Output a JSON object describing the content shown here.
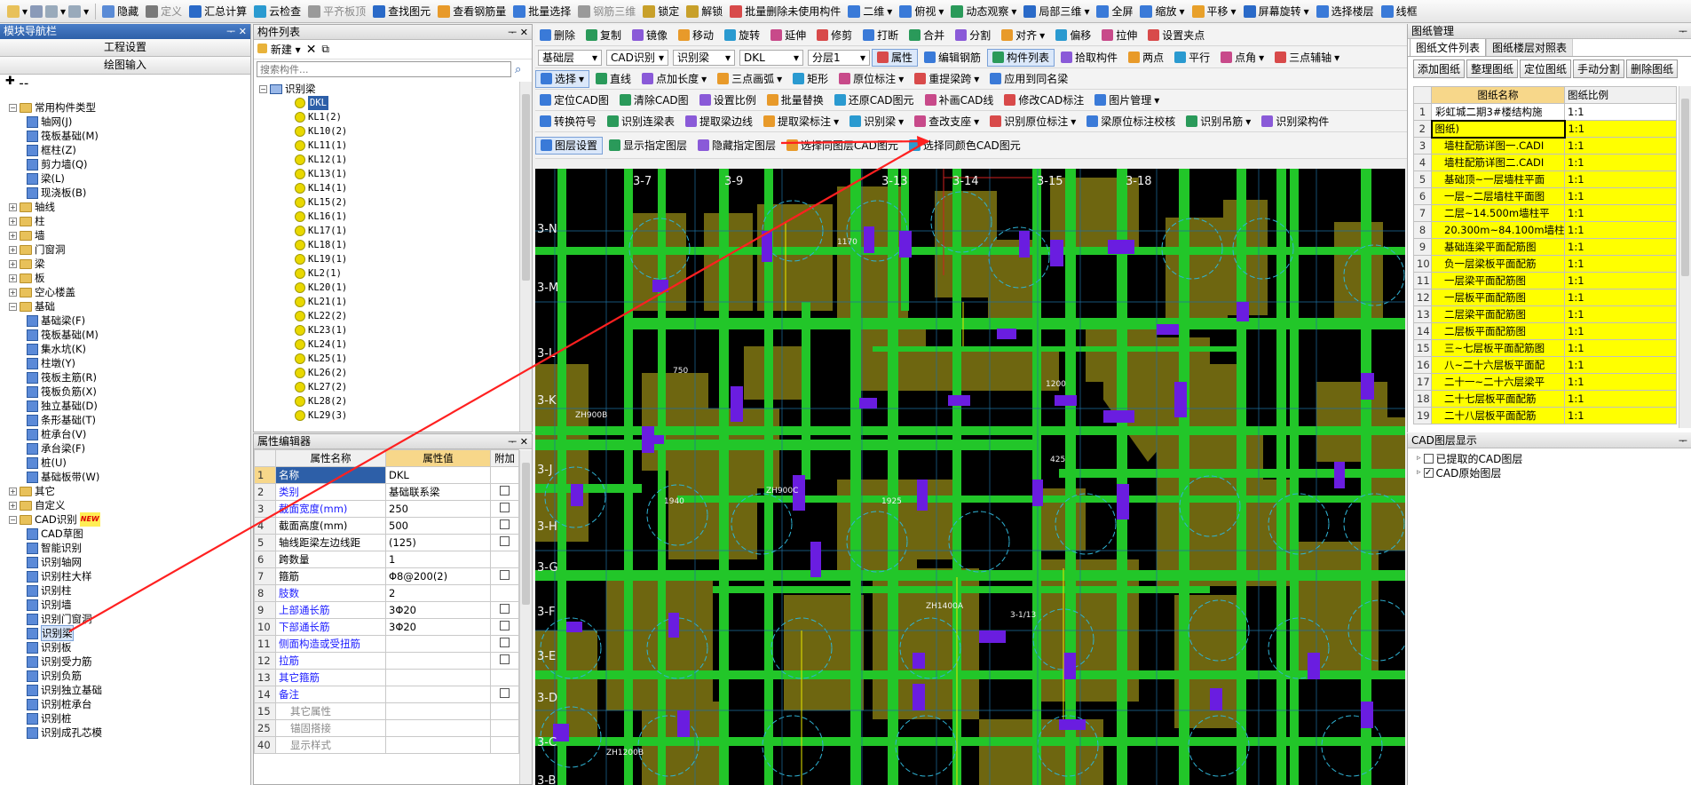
{
  "toolbar": [
    "隐藏",
    "定义",
    "汇总计算",
    "云检查",
    "平齐板顶",
    "查找图元",
    "查看钢筋量",
    "批量选择",
    "钢筋三维",
    "锁定",
    "解锁",
    "批量删除未使用构件",
    "二维",
    "俯视",
    "动态观察",
    "局部三维",
    "全屏",
    "缩放",
    "平移",
    "屏幕旋转",
    "选择楼层",
    "线框"
  ],
  "nav": {
    "title": "模块导航栏",
    "btn1": "工程设置",
    "btn2": "绘图输入",
    "tree": [
      "常用构件类型",
      "轴网(J)",
      "筏板基础(M)",
      "框柱(Z)",
      "剪力墙(Q)",
      "梁(L)",
      "现浇板(B)",
      "轴线",
      "柱",
      "墙",
      "门窗洞",
      "梁",
      "板",
      "空心楼盖",
      "基础",
      "基础梁(F)",
      "筏板基础(M)",
      "集水坑(K)",
      "柱墩(Y)",
      "筏板主筋(R)",
      "筏板负筋(X)",
      "独立基础(D)",
      "条形基础(T)",
      "桩承台(V)",
      "承台梁(F)",
      "桩(U)",
      "基础板带(W)",
      "其它",
      "自定义",
      "CAD识别",
      "CAD草图",
      "智能识别",
      "识别轴网",
      "识别柱大样",
      "识别柱",
      "识别墙",
      "识别门窗洞",
      "识别梁",
      "识别板",
      "识别受力筋",
      "识别负筋",
      "识别独立基础",
      "识别桩承台",
      "识别桩",
      "识别成孔芯模"
    ],
    "new_badge": "NEW"
  },
  "comp": {
    "title": "构件列表",
    "new": "新建",
    "search_ph": "搜索构件...",
    "root": "识别梁",
    "items": [
      "DKL",
      "KL1(2)",
      "KL10(2)",
      "KL11(1)",
      "KL12(1)",
      "KL13(1)",
      "KL14(1)",
      "KL15(2)",
      "KL16(1)",
      "KL17(1)",
      "KL18(1)",
      "KL19(1)",
      "KL2(1)",
      "KL20(1)",
      "KL21(1)",
      "KL22(2)",
      "KL23(1)",
      "KL24(1)",
      "KL25(1)",
      "KL26(2)",
      "KL27(2)",
      "KL28(2)",
      "KL29(3)"
    ]
  },
  "prop": {
    "title": "属性编辑器",
    "h_name": "属性名称",
    "h_val": "属性值",
    "h_add": "附加",
    "rows": [
      [
        "1",
        "名称",
        "DKL"
      ],
      [
        "2",
        "类别",
        "基础联系梁"
      ],
      [
        "3",
        "截面宽度(mm)",
        "250"
      ],
      [
        "4",
        "截面高度(mm)",
        "500"
      ],
      [
        "5",
        "轴线距梁左边线距",
        "(125)"
      ],
      [
        "6",
        "跨数量",
        "1"
      ],
      [
        "7",
        "箍筋",
        "Φ8@200(2)"
      ],
      [
        "8",
        "肢数",
        "2"
      ],
      [
        "9",
        "上部通长筋",
        "3Φ20"
      ],
      [
        "10",
        "下部通长筋",
        "3Φ20"
      ],
      [
        "11",
        "侧面构造或受扭筋",
        ""
      ],
      [
        "12",
        "拉筋",
        ""
      ],
      [
        "13",
        "其它箍筋",
        ""
      ],
      [
        "14",
        "备注",
        ""
      ],
      [
        "15",
        "其它属性",
        ""
      ],
      [
        "25",
        "锚固搭接",
        ""
      ],
      [
        "40",
        "显示样式",
        ""
      ]
    ]
  },
  "cad": {
    "bar1": [
      "删除",
      "复制",
      "镜像",
      "移动",
      "旋转",
      "延伸",
      "修剪",
      "打断",
      "合并",
      "分割",
      "对齐",
      "偏移",
      "拉伸",
      "设置夹点"
    ],
    "bar2": {
      "floor": "基础层",
      "cad": "CAD识别",
      "beam": "识别梁",
      "type": "DKL",
      "layer": "分层1",
      "items": [
        "属性",
        "编辑钢筋",
        "构件列表",
        "拾取构件",
        "两点",
        "平行",
        "点角",
        "三点辅轴"
      ]
    },
    "bar3": [
      "选择",
      "直线",
      "点加长度",
      "三点画弧",
      "矩形",
      "原位标注",
      "重提梁跨",
      "应用到同名梁"
    ],
    "bar4": [
      "定位CAD图",
      "清除CAD图",
      "设置比例",
      "批量替换",
      "还原CAD图元",
      "补画CAD线",
      "修改CAD标注",
      "图片管理"
    ],
    "bar5": [
      "转换符号",
      "识别连梁表",
      "提取梁边线",
      "提取梁标注",
      "识别梁",
      "查改支座",
      "识别原位标注",
      "梁原位标注校核",
      "识别吊筋",
      "识别梁构件"
    ],
    "bar6": [
      "图层设置",
      "显示指定图层",
      "隐藏指定图层",
      "选择同图层CAD图元",
      "选择同颜色CAD图元"
    ],
    "labels": [
      "3-7",
      "3-9",
      "3-13",
      "3-14",
      "3-15",
      "3-18",
      "3-N",
      "3-M",
      "3-L",
      "3-K",
      "3-J",
      "3-H",
      "3-G",
      "3-F",
      "3-E",
      "3-D",
      "3-C",
      "3-B",
      "3-1/13",
      "ZH900B",
      "ZH900C",
      "ZH1400A",
      "ZH1200B",
      "750",
      "1200",
      "1940",
      "1925",
      "1170",
      "425"
    ]
  },
  "draw": {
    "title": "图纸管理",
    "tab1": "图纸文件列表",
    "tab2": "图纸楼层对照表",
    "btns": [
      "添加图纸",
      "整理图纸",
      "定位图纸",
      "手动分割",
      "删除图纸"
    ],
    "h_name": "图纸名称",
    "h_ratio": "图纸比例",
    "rows": [
      [
        "1",
        "彩虹城二期3#楼结构施",
        "1:1"
      ],
      [
        "2",
        "图纸)",
        "1:1"
      ],
      [
        "3",
        "墙柱配筋详图一.CADI",
        "1:1"
      ],
      [
        "4",
        "墙柱配筋详图二.CADI",
        "1:1"
      ],
      [
        "5",
        "基础顶~一层墙柱平面",
        "1:1"
      ],
      [
        "6",
        "一层~二层墙柱平面图",
        "1:1"
      ],
      [
        "7",
        "二层~14.500m墙柱平",
        "1:1"
      ],
      [
        "8",
        "20.300m~84.100m墙柱",
        "1:1"
      ],
      [
        "9",
        "基础连梁平面配筋图",
        "1:1"
      ],
      [
        "10",
        "负一层梁板平面配筋",
        "1:1"
      ],
      [
        "11",
        "一层梁平面配筋图",
        "1:1"
      ],
      [
        "12",
        "一层板平面配筋图",
        "1:1"
      ],
      [
        "13",
        "二层梁平面配筋图",
        "1:1"
      ],
      [
        "14",
        "二层板平面配筋图",
        "1:1"
      ],
      [
        "15",
        "三~七层板平面配筋图",
        "1:1"
      ],
      [
        "16",
        "八~二十六层板平面配",
        "1:1"
      ],
      [
        "17",
        "二十一~二十六层梁平",
        "1:1"
      ],
      [
        "18",
        "二十七层板平面配筋",
        "1:1"
      ],
      [
        "19",
        "二十八层板平面配筋",
        "1:1"
      ]
    ]
  },
  "layer": {
    "title": "CAD图层显示",
    "i1": "已提取的CAD图层",
    "i2": "CAD原始图层"
  },
  "colors": {
    "cad_bg": "#000000",
    "beam": "#22c629",
    "column": "#6e6610",
    "cyan": "#2fb4d6",
    "purple": "#6a1de0",
    "annotation_red": "#ff2020",
    "highlight": "#ffff00",
    "title_blue": "#2d5fa8"
  }
}
